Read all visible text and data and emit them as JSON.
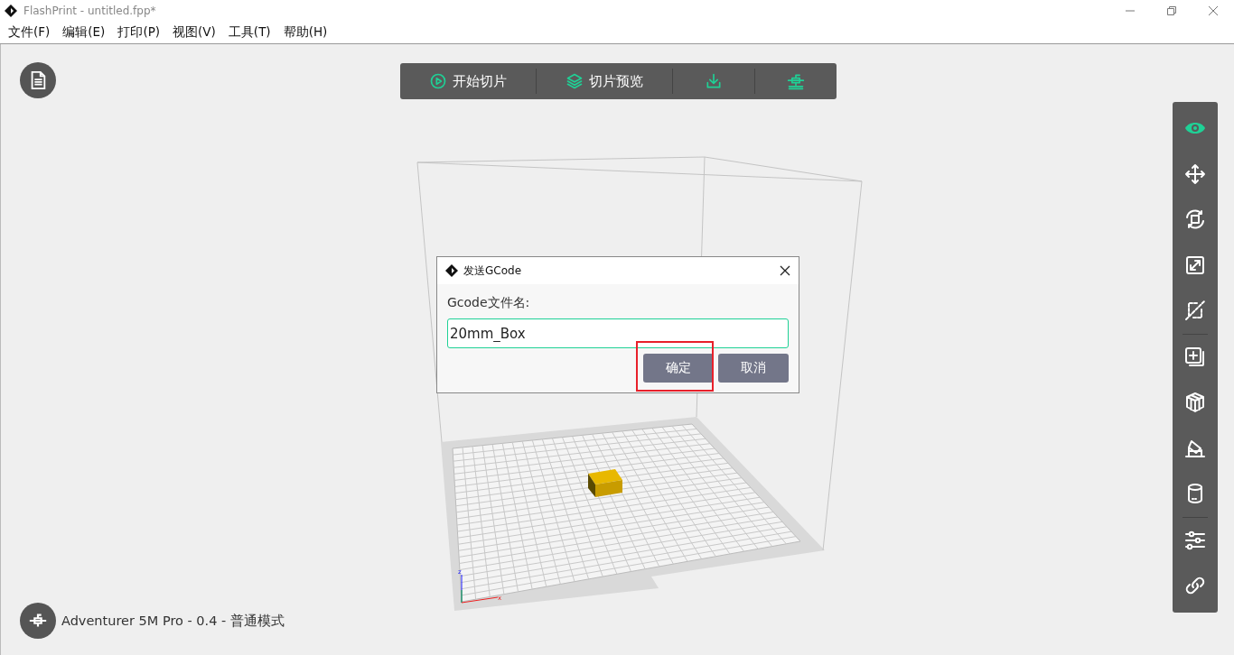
{
  "window": {
    "title": "FlashPrint - untitled.fpp*"
  },
  "menu": [
    "文件(F)",
    "编辑(E)",
    "打印(P)",
    "视图(V)",
    "工具(T)",
    "帮助(H)"
  ],
  "toolbar": [
    {
      "kind": "play",
      "label": "开始切片"
    },
    {
      "kind": "layers",
      "label": "切片预览"
    },
    {
      "kind": "download"
    },
    {
      "kind": "nozzle"
    }
  ],
  "sidebar": {
    "tools": [
      {
        "kind": "eye",
        "selected": true
      },
      {
        "kind": "move",
        "selected": false
      },
      {
        "kind": "rotate",
        "selected": false
      },
      {
        "kind": "scale",
        "selected": false
      },
      {
        "kind": "cut",
        "selected": false
      },
      {
        "kind": "divider"
      },
      {
        "kind": "add",
        "selected": false
      },
      {
        "kind": "split",
        "selected": false
      },
      {
        "kind": "support",
        "selected": false
      },
      {
        "kind": "cylinder",
        "selected": false
      },
      {
        "kind": "divider"
      },
      {
        "kind": "sliders",
        "selected": false
      },
      {
        "kind": "link",
        "selected": false
      }
    ]
  },
  "scene": {
    "axis_labels": [
      "z",
      "x"
    ]
  },
  "dialog": {
    "title": "发送GCode",
    "label": "Gcode文件名:",
    "value": "20mm_Box",
    "buttons": [
      {
        "label": "确定",
        "highlighted": true
      },
      {
        "label": "取消",
        "highlighted": false
      }
    ]
  },
  "status": {
    "printer": "Adventurer 5M Pro - 0.4 - 普通模式"
  }
}
